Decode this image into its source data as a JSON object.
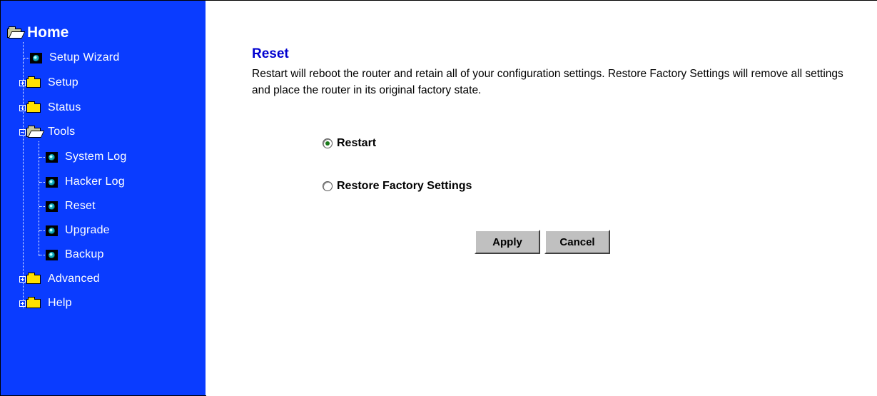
{
  "sidebar": {
    "home_label": "Home",
    "items": {
      "setup_wizard": "Setup Wizard",
      "setup": "Setup",
      "status": "Status",
      "tools": "Tools",
      "system_log": "System Log",
      "hacker_log": "Hacker Log",
      "reset": "Reset",
      "upgrade": "Upgrade",
      "backup": "Backup",
      "advanced": "Advanced",
      "help": "Help"
    },
    "background_color": "#0a3cff"
  },
  "main": {
    "title": "Reset",
    "description": "Restart will reboot the router and retain all of your configuration settings. Restore Factory Settings will remove all settings and place the router in its original factory state.",
    "options": {
      "restart": "Restart",
      "restore": "Restore Factory Settings"
    },
    "selected_option": "Restart",
    "buttons": {
      "apply": "Apply",
      "cancel": "Cancel"
    },
    "title_color": "#0000d0"
  }
}
